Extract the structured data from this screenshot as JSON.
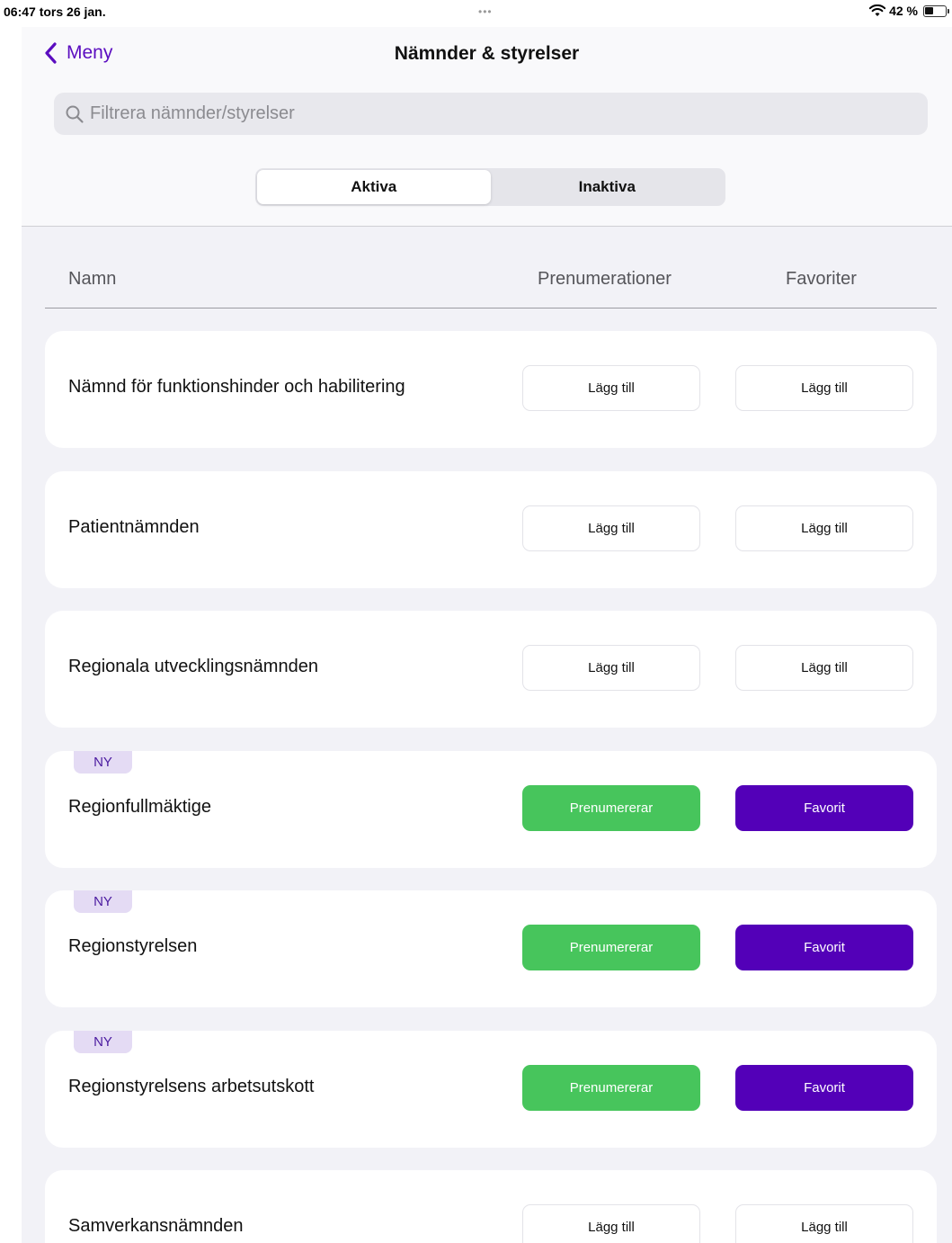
{
  "status_bar": {
    "time_date": "06:47  tors 26 jan.",
    "dots": "•••",
    "battery": "42 %"
  },
  "nav": {
    "back_label": "Meny",
    "title": "Nämnder & styrelser"
  },
  "search": {
    "placeholder": "Filtrera nämnder/styrelser",
    "value": ""
  },
  "segments": [
    {
      "label": "Aktiva",
      "selected": true
    },
    {
      "label": "Inaktiva",
      "selected": false
    }
  ],
  "columns": {
    "name": "Namn",
    "subscriptions": "Prenumerationer",
    "favorites": "Favoriter"
  },
  "colors": {
    "accent": "#5b0dc0",
    "subscribed": "#47c55c",
    "favorite": "#5300b8",
    "badge_bg": "#e4dbf4"
  },
  "rows": [
    {
      "name": "Nämnd för funktionshinder och habilitering",
      "badge": "",
      "sub_label": "Lägg till",
      "fav_label": "Lägg till"
    },
    {
      "name": "Patientnämnden",
      "badge": "",
      "sub_label": "Lägg till",
      "fav_label": "Lägg till"
    },
    {
      "name": "Regionala utvecklingsnämnden",
      "badge": "",
      "sub_label": "Lägg till",
      "fav_label": "Lägg till"
    },
    {
      "name": "Regionfullmäktige",
      "badge": "NY",
      "sub_label": "Prenumererar",
      "fav_label": "Favorit"
    },
    {
      "name": "Regionstyrelsen",
      "badge": "NY",
      "sub_label": "Prenumererar",
      "fav_label": "Favorit"
    },
    {
      "name": "Regionstyrelsens arbetsutskott",
      "badge": "NY",
      "sub_label": "Prenumererar",
      "fav_label": "Favorit"
    },
    {
      "name": "Samverkansnämnden",
      "badge": "",
      "sub_label": "Lägg till",
      "fav_label": "Lägg till"
    }
  ]
}
